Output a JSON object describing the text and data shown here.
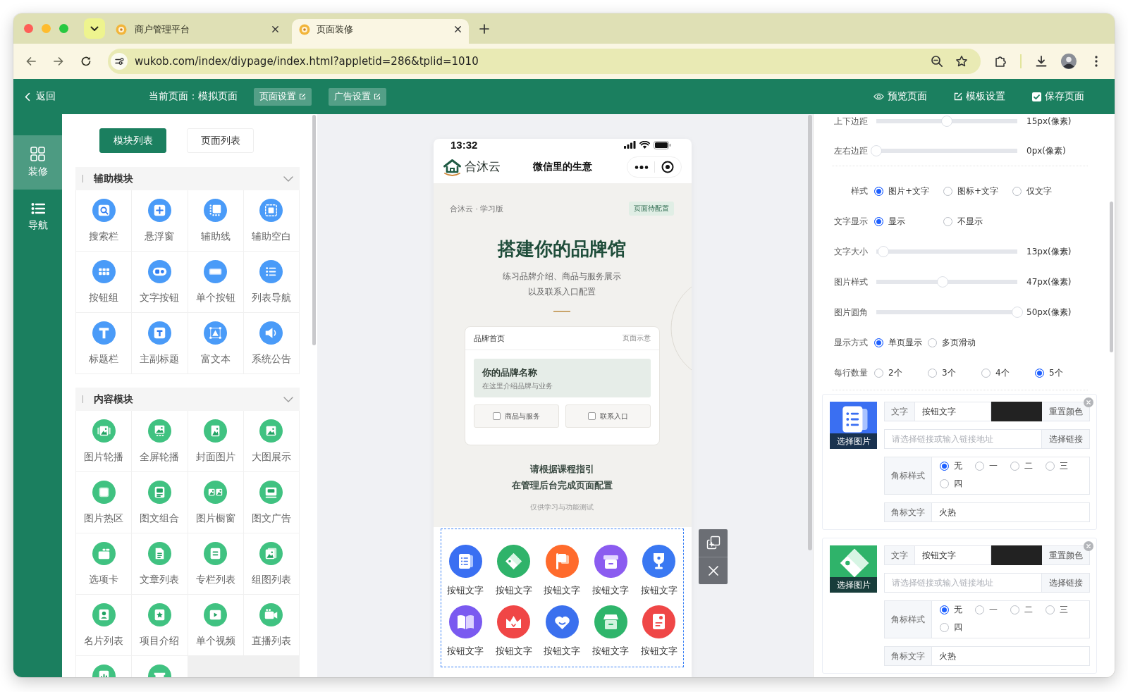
{
  "browser": {
    "tabs": [
      {
        "title": "商户管理平台",
        "selected": false
      },
      {
        "title": "页面装修",
        "selected": true
      }
    ],
    "url": "wukob.com/index/diypage/index.html?appletid=286&tplid=1010"
  },
  "header": {
    "back": "返回",
    "current_page": "当前页面：模拟页面",
    "page_buttons": [
      "页面设置",
      "广告设置"
    ],
    "actions": [
      {
        "kind": "preview",
        "label": "预览页面"
      },
      {
        "kind": "template",
        "label": "模板设置"
      },
      {
        "kind": "save",
        "label": "保存页面"
      }
    ]
  },
  "sidebar": {
    "items": [
      {
        "label": "装修",
        "selected": true
      },
      {
        "label": "导航",
        "selected": false
      }
    ]
  },
  "module_panel": {
    "tabs": [
      {
        "label": "模块列表",
        "selected": true
      },
      {
        "label": "页面列表",
        "selected": false
      }
    ],
    "sections": [
      {
        "title": "辅助模块",
        "expanded": true,
        "items": [
          {
            "kind": "module",
            "label": "搜索栏"
          },
          {
            "kind": "module",
            "label": "悬浮窗"
          },
          {
            "kind": "module",
            "label": "辅助线"
          },
          {
            "kind": "module",
            "label": "辅助空白"
          },
          {
            "kind": "module",
            "label": "按钮组"
          },
          {
            "kind": "module",
            "label": "文字按钮"
          },
          {
            "kind": "module",
            "label": "单个按钮"
          },
          {
            "kind": "module",
            "label": "列表导航"
          },
          {
            "kind": "module",
            "label": "标题栏"
          },
          {
            "kind": "module",
            "label": "主副标题"
          },
          {
            "kind": "module",
            "label": "富文本"
          },
          {
            "kind": "module",
            "label": "系统公告"
          }
        ]
      },
      {
        "title": "内容模块",
        "expanded": true,
        "items": [
          {
            "kind": "module",
            "label": "图片轮播"
          },
          {
            "kind": "module",
            "label": "全屏轮播"
          },
          {
            "kind": "module",
            "label": "封面图片"
          },
          {
            "kind": "module",
            "label": "大图展示"
          },
          {
            "kind": "module",
            "label": "图片热区"
          },
          {
            "kind": "module",
            "label": "图文组合"
          },
          {
            "kind": "module",
            "label": "图片橱窗"
          },
          {
            "kind": "module",
            "label": "图文广告"
          },
          {
            "kind": "module",
            "label": "选项卡"
          },
          {
            "kind": "module",
            "label": "文章列表"
          },
          {
            "kind": "module",
            "label": "专栏列表"
          },
          {
            "kind": "module",
            "label": "组图列表"
          },
          {
            "kind": "module",
            "label": "名片列表"
          },
          {
            "kind": "module",
            "label": "项目介绍"
          },
          {
            "kind": "module",
            "label": "单个视频"
          },
          {
            "kind": "module",
            "label": "直播列表"
          },
          {
            "kind": "cut_off"
          },
          {
            "kind": "cut_off"
          }
        ]
      }
    ]
  },
  "phone": {
    "time": "13:32",
    "brand": "合沐云",
    "title": "微信里的生意",
    "eyebrow": "合沐云 · 学习版",
    "badge": "页面待配置",
    "heading": "搭建你的品牌馆",
    "subtitle": [
      "练习品牌介绍、商品与服务展示",
      "以及联系入口配置"
    ],
    "card": {
      "title": "品牌首页",
      "note": "页面示意",
      "brand_name": "你的品牌名称",
      "brand_desc": "在这里介绍品牌与业务",
      "buttons": [
        "商品与服务",
        "联系入口"
      ]
    },
    "guide": [
      "请根据课程指引",
      "在管理后台完成页面配置"
    ],
    "disclaimer": "仅供学习与功能测试",
    "nav_buttons": [
      "按钮文字",
      "按钮文字",
      "按钮文字",
      "按钮文字",
      "按钮文字",
      "按钮文字",
      "按钮文字",
      "按钮文字",
      "按钮文字",
      "按钮文字"
    ]
  },
  "settings": {
    "margins": [
      {
        "label": "上下边距",
        "level": 0.5,
        "reading": "15px(像素)"
      },
      {
        "label": "左右边距",
        "level": 0,
        "reading": "0px(像素)"
      }
    ],
    "display": [
      {
        "kind": "radio",
        "label": "样式",
        "options": [
          {
            "label": "图片+文字",
            "selected": true
          },
          {
            "label": "图标+文字",
            "selected": false
          },
          {
            "label": "仅文字",
            "selected": false
          }
        ]
      },
      {
        "kind": "radio",
        "label": "文字显示",
        "options": [
          {
            "label": "显示",
            "selected": true
          },
          {
            "label": "不显示",
            "selected": false
          }
        ]
      },
      {
        "kind": "slider",
        "label": "文字大小",
        "level": 0.05,
        "reading": "13px(像素)"
      },
      {
        "kind": "slider",
        "label": "图片样式",
        "level": 0.47,
        "reading": "47px(像素)"
      },
      {
        "kind": "slider",
        "label": "图片圆角",
        "level": 1,
        "reading": "50px(像素)"
      },
      {
        "kind": "radio",
        "label": "显示方式",
        "options": [
          {
            "label": "单页显示",
            "selected": true
          },
          {
            "label": "多页滑动",
            "selected": false
          }
        ]
      },
      {
        "kind": "radio",
        "label": "每行数量",
        "options": [
          {
            "label": "2个",
            "selected": false
          },
          {
            "label": "3个",
            "selected": false
          },
          {
            "label": "4个",
            "selected": false
          },
          {
            "label": "5个",
            "selected": true
          }
        ]
      }
    ],
    "buttons": [
      {
        "image_button": "选择图片",
        "text_label": "文字",
        "text": "按钮文字",
        "color": "#222222",
        "reset": "重置颜色",
        "link_placeholder": "请选择链接或输入链接地址",
        "link_button": "选择链接",
        "badge_style_label": "角标样式",
        "badge_styles": [
          {
            "label": "无",
            "selected": true
          },
          {
            "label": "一",
            "selected": false
          },
          {
            "label": "二",
            "selected": false
          },
          {
            "label": "三",
            "selected": false
          },
          {
            "label": "四",
            "selected": false
          }
        ],
        "badge_text_label": "角标文字",
        "badge_text": "火热"
      },
      {
        "image_button": "选择图片",
        "text_label": "文字",
        "text": "按钮文字",
        "color": "#222222",
        "reset": "重置颜色",
        "link_placeholder": "请选择链接或输入链接地址",
        "link_button": "选择链接",
        "badge_style_label": "角标样式",
        "badge_styles": [
          {
            "label": "无",
            "selected": true
          },
          {
            "label": "一",
            "selected": false
          },
          {
            "label": "二",
            "selected": false
          },
          {
            "label": "三",
            "selected": false
          },
          {
            "label": "四",
            "selected": false
          }
        ],
        "badge_text_label": "角标文字",
        "badge_text": "火热"
      }
    ]
  }
}
